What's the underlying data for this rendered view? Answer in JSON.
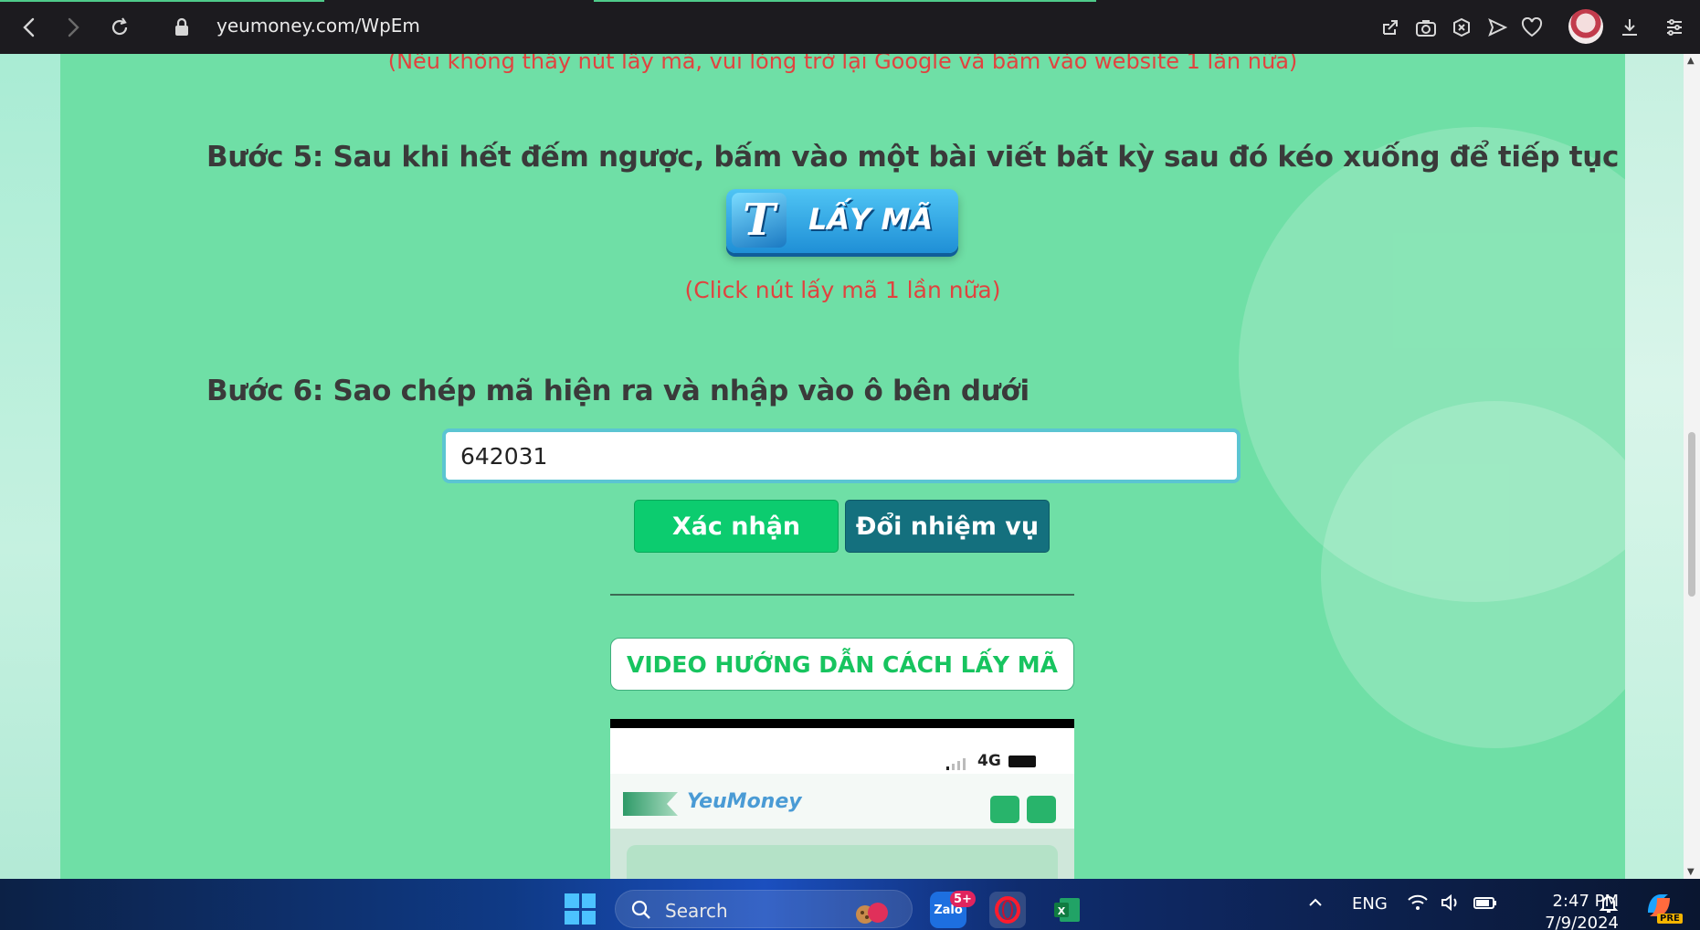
{
  "browser": {
    "url": "yeumoney.com/WpEm",
    "icons": [
      "back-icon",
      "forward-icon",
      "reload-icon",
      "lock-icon",
      "share-icon",
      "camera-icon",
      "close-circle-icon",
      "send-icon",
      "heart-icon",
      "avatar",
      "download-icon",
      "menu-icon"
    ]
  },
  "page": {
    "top_notice": "(Nếu không thấy nút lấy mã, vui lòng trở lại Google và bấm vào website 1 lần nữa)",
    "step5": "Bước 5: Sau khi hết đếm ngược, bấm vào một bài viết bất kỳ sau đó kéo xuống để tiếp tục",
    "get_code_button": {
      "badge": "T",
      "label": "LẤY MÃ"
    },
    "click_note": "(Click nút lấy mã 1 lần nữa)",
    "step6": "Bước 6: Sao chép mã hiện ra và nhập vào ô bên dưới",
    "code_input_value": "642031",
    "confirm_button": "Xác nhận",
    "change_task_button": "Đổi nhiệm vụ",
    "video_button": "VIDEO HƯỚNG DẪN CÁCH LẤY MÃ",
    "video_preview": {
      "network": "4G",
      "logo": "YeuMoney"
    }
  },
  "colors": {
    "page_green": "#6fdfa6",
    "notice_red": "#e0433f",
    "confirm_green": "#0ccc6f",
    "change_teal": "#14707e"
  },
  "taskbar": {
    "search_label": "Search",
    "zalo_badge": "5+",
    "zalo_label": "Zalo",
    "language": "ENG",
    "time": "2:47 PM",
    "date": "7/9/2024",
    "copilot_badge": "PRE"
  }
}
